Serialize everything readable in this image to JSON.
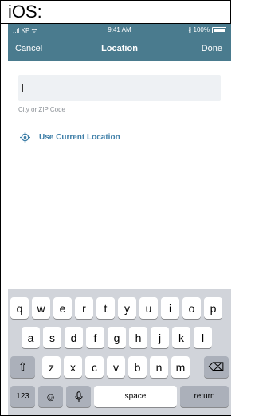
{
  "heading": "iOS:",
  "status_bar": {
    "carrier": "..ıl KP ᯤ",
    "time": "9:41 AM",
    "battery": "∦ 100%"
  },
  "nav": {
    "cancel": "Cancel",
    "title": "Location",
    "done": "Done"
  },
  "location_input": {
    "value": "",
    "hint": "City or ZIP Code"
  },
  "use_current_location": "Use Current Location",
  "keyboard": {
    "row1": [
      "q",
      "w",
      "e",
      "r",
      "t",
      "y",
      "u",
      "i",
      "o",
      "p"
    ],
    "row2": [
      "a",
      "s",
      "d",
      "f",
      "g",
      "h",
      "j",
      "k",
      "l"
    ],
    "row3": [
      "z",
      "x",
      "c",
      "v",
      "b",
      "n",
      "m"
    ],
    "numbers": "123",
    "space": "space",
    "return": "return",
    "shift_icon": "⇧",
    "emoji_icon": "☺",
    "mic_icon": "🎙",
    "delete_icon": "⌫"
  },
  "colors": {
    "bar": "#4a7b8e",
    "accent": "#3f7fa8",
    "keyboard_bg": "#d1d4da"
  }
}
